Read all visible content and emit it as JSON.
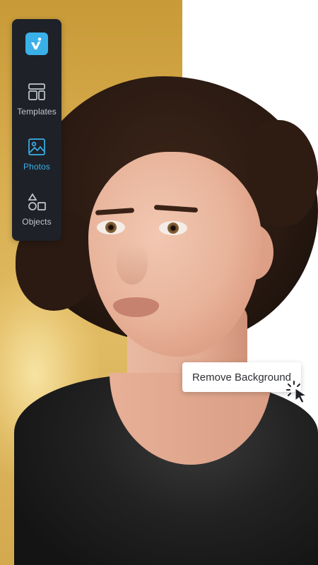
{
  "toolbar": {
    "logo_icon": "brand-logo-icon",
    "items": [
      {
        "label": "Templates",
        "icon": "templates-icon",
        "active": false
      },
      {
        "label": "Photos",
        "icon": "photos-icon",
        "active": true
      },
      {
        "label": "Objects",
        "icon": "objects-icon",
        "active": false
      }
    ]
  },
  "context_action": {
    "label": "Remove Background",
    "cursor_icon": "click-cursor-icon"
  },
  "colors": {
    "toolbar_bg": "#1e2127",
    "accent": "#3ab0e8",
    "label_inactive": "#c4c8cf",
    "backdrop_left": "#d4a94e",
    "backdrop_right": "#ffffff"
  }
}
